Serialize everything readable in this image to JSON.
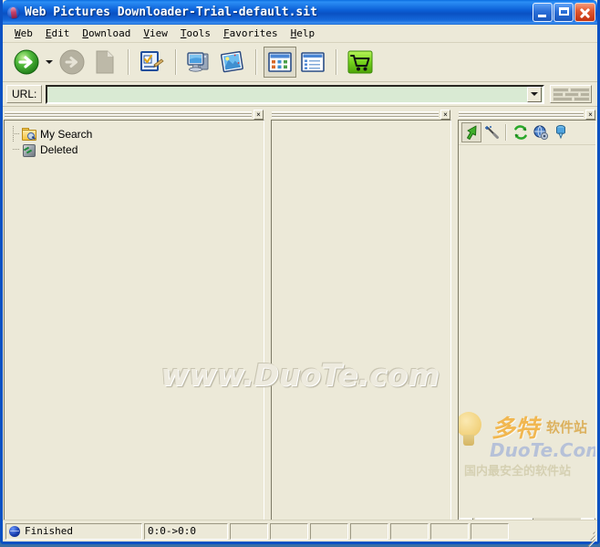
{
  "window": {
    "title": "Web Pictures Downloader-Trial-default.sit",
    "app_icon": "app-icon",
    "controls": {
      "minimize": "Minimize",
      "maximize": "Maximize",
      "close": "Close"
    }
  },
  "menubar": {
    "items": [
      {
        "label": "Web",
        "accel": "W",
        "rest": "eb"
      },
      {
        "label": "Edit",
        "accel": "E",
        "rest": "dit"
      },
      {
        "label": "Download",
        "accel": "D",
        "rest": "ownload"
      },
      {
        "label": "View",
        "accel": "V",
        "rest": "iew"
      },
      {
        "label": "Tools",
        "accel": "T",
        "rest": "ools"
      },
      {
        "label": "Favorites",
        "accel": "F",
        "rest": "avorites"
      },
      {
        "label": "Help",
        "accel": "H",
        "rest": "elp"
      }
    ]
  },
  "toolbar": {
    "buttons": [
      {
        "name": "go-button",
        "icon": "green-right-arrow-icon",
        "enabled": true
      },
      {
        "name": "go-dropdown",
        "icon": "chevron-down-icon",
        "enabled": true
      },
      {
        "name": "stop-button",
        "icon": "gray-right-arrow-icon",
        "enabled": false
      },
      {
        "name": "new-page-button",
        "icon": "page-icon",
        "enabled": false
      },
      {
        "name": "task-list-button",
        "icon": "checklist-pen-icon",
        "enabled": true
      },
      {
        "name": "computer-button",
        "icon": "computer-icon",
        "enabled": true
      },
      {
        "name": "pictures-button",
        "icon": "picture-icon",
        "enabled": true
      },
      {
        "name": "thumbnail-view-button",
        "icon": "thumbnail-grid-icon",
        "enabled": true,
        "pressed": true
      },
      {
        "name": "details-view-button",
        "icon": "details-list-icon",
        "enabled": true
      },
      {
        "name": "buy-button",
        "icon": "shopping-cart-icon",
        "enabled": true
      }
    ]
  },
  "urlbar": {
    "label": "URL:",
    "value": "",
    "placeholder": "",
    "dropdown_icon": "chevron-down-icon",
    "grip_icon": "brick-grip-icon"
  },
  "panes": {
    "tree": {
      "close_label": "×",
      "items": [
        {
          "label": "My Search",
          "icon": "search-folder-icon"
        },
        {
          "label": "Deleted",
          "icon": "recycle-bin-icon"
        }
      ]
    },
    "center": {
      "close_label": "×"
    },
    "right": {
      "close_label": "×",
      "toolbar": [
        {
          "name": "select-tool",
          "icon": "green-cursor-arrow-icon",
          "pressed": true
        },
        {
          "name": "magic-wand-tool",
          "icon": "magic-wand-icon",
          "pressed": false
        },
        {
          "name": "refresh-button",
          "icon": "green-refresh-icon",
          "pressed": false
        },
        {
          "name": "globe-settings-button",
          "icon": "globe-gear-icon",
          "pressed": false
        },
        {
          "name": "download-item-button",
          "icon": "blue-download-icon",
          "pressed": false
        }
      ],
      "scroll": {
        "left_arrow": "❮",
        "right_arrow": "❯"
      }
    }
  },
  "watermarks": {
    "main": "www.DuoTe.com",
    "corner_cn_big": "多特",
    "corner_cn_small": "软件站",
    "corner_en": "DuoTe.Com",
    "corner_tagline": "国内最安全的软件站"
  },
  "statusbar": {
    "status_icon": "globe-icon",
    "status_text": "Finished",
    "coords_text": "0:0->0:0",
    "empty_panels": 7,
    "resize_grip": "resize-grip-icon"
  },
  "colors": {
    "window_face": "#ece9d8",
    "title_blue": "#0a51c3",
    "url_field": "#d9ead3",
    "accent_green": "#2ca02c",
    "close_red": "#c23210"
  }
}
